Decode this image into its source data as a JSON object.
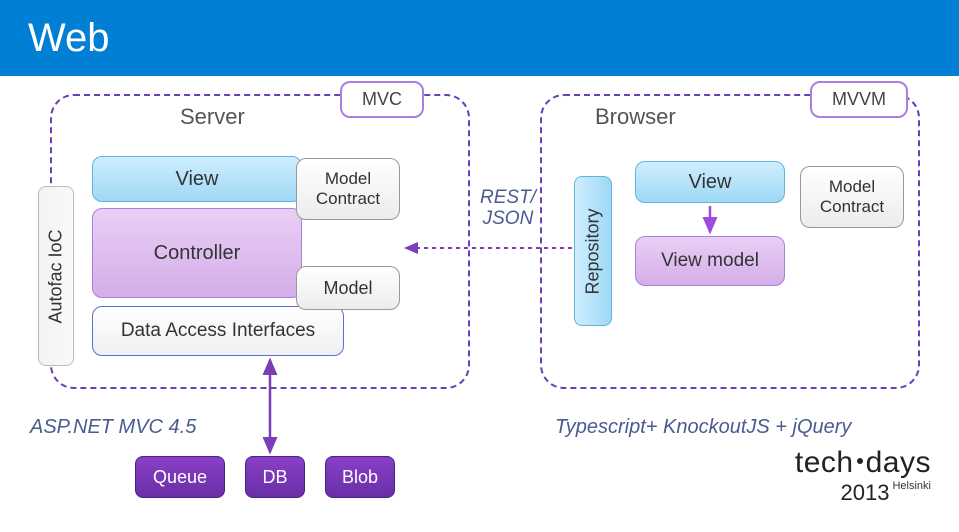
{
  "header": {
    "title": "Web"
  },
  "patterns": {
    "mvc": "MVC",
    "mvvm": "MVVM"
  },
  "labels": {
    "server": "Server",
    "browser": "Browser",
    "rest_json": "REST/\nJSON"
  },
  "server": {
    "ioc": "Autofac IoC",
    "view": "View",
    "controller": "Controller",
    "data_access": "Data Access Interfaces",
    "model_contract": "Model\nContract",
    "model": "Model"
  },
  "browser": {
    "repository": "Repository",
    "view": "View",
    "view_model": "View model",
    "model_contract": "Model\nContract"
  },
  "captions": {
    "left": "ASP.NET MVC 4.5",
    "right": "Typescript+ KnockoutJS + jQuery"
  },
  "storage": {
    "queue": "Queue",
    "db": "DB",
    "blob": "Blob"
  },
  "logo": {
    "line1a": "tech",
    "line1b": "days",
    "year": "2013",
    "city": "Helsinki"
  }
}
